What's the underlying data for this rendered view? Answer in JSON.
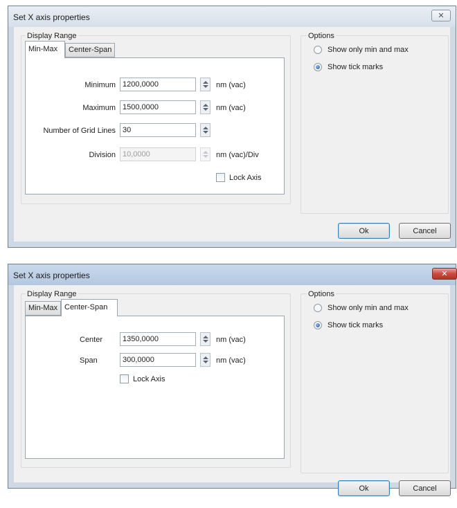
{
  "dialog1": {
    "title": "Set X axis properties",
    "close_symbol": "✕",
    "display_range_label": "Display Range",
    "tabs": [
      {
        "label": "Min-Max"
      },
      {
        "label": "Center-Span"
      }
    ],
    "active_tab": "Min-Max",
    "minimum_label": "Minimum",
    "minimum_value": "1200,0000",
    "minimum_unit": "nm (vac)",
    "maximum_label": "Maximum",
    "maximum_value": "1500,0000",
    "maximum_unit": "nm (vac)",
    "gridlines_label": "Number of Grid Lines",
    "gridlines_value": "30",
    "division_label": "Division",
    "division_value": "10,0000",
    "division_unit": "nm (vac)/Div",
    "lock_axis_label": "Lock Axis",
    "lock_axis_checked": false,
    "options_label": "Options",
    "option_min_max": "Show only min and max",
    "option_tick_marks": "Show tick marks",
    "selected_option": "Show tick marks",
    "ok_label": "Ok",
    "cancel_label": "Cancel"
  },
  "dialog2": {
    "title": "Set X axis properties",
    "close_symbol": "✕",
    "display_range_label": "Display Range",
    "tabs": [
      {
        "label": "Min-Max"
      },
      {
        "label": "Center-Span"
      }
    ],
    "active_tab": "Center-Span",
    "center_label": "Center",
    "center_value": "1350,0000",
    "center_unit": "nm (vac)",
    "span_label": "Span",
    "span_value": "300,0000",
    "span_unit": "nm (vac)",
    "lock_axis_label": "Lock Axis",
    "lock_axis_checked": false,
    "options_label": "Options",
    "option_min_max": "Show only min and max",
    "option_tick_marks": "Show tick marks",
    "selected_option": "Show tick marks",
    "ok_label": "Ok",
    "cancel_label": "Cancel"
  },
  "colors": {
    "dialog_frame": "#cfd9e4",
    "dialog_body": "#f0f0f0",
    "close_button_active": "#c84c3f",
    "default_button_border": "#3c7fb1"
  },
  "icons": {
    "close": "close-icon",
    "spinner": "spinner-arrows-icon",
    "radio": "radio-dot-icon"
  }
}
